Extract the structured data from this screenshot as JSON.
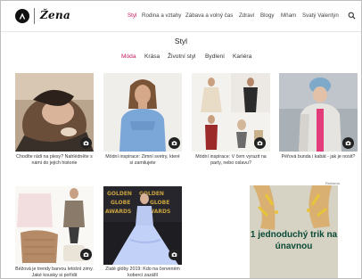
{
  "header": {
    "logo_text": "Žena",
    "nav": [
      "Styl",
      "Rodina a vztahy",
      "Zábava a volný čas",
      "Zdraví",
      "Blogy",
      "Mňam",
      "Svatý Valentýn"
    ],
    "active_nav": "Styl",
    "accent_color": "#c2185b"
  },
  "section": {
    "title": "Styl",
    "tabs": [
      "Móda",
      "Krása",
      "Životní styl",
      "Bydlení",
      "Kariéra"
    ],
    "active_tab": "Móda"
  },
  "articles": [
    {
      "caption": "Chodíte rádi na plesy? Nahlédněte s námi do jejich historie",
      "icon": "camera-icon"
    },
    {
      "caption": "Módní inspirace: Zimní svetry, které si zamilujete",
      "icon": "camera-icon"
    },
    {
      "caption": "Módní inspirace: V čem vyrazit na party, nebo oslavu?",
      "icon": "camera-icon"
    },
    {
      "caption": "Péřová bunda i kabát - jak je nosit?",
      "icon": "camera-icon"
    },
    {
      "caption": "Béžová je trendy barvou letošní zimy. Jaké kousky si pořídit",
      "icon": "camera-icon"
    },
    {
      "caption": "Zlaté glóby 2019: Kdo na červeném koberci zazářil",
      "icon": "camera-icon"
    }
  ],
  "ad": {
    "label": "Reklama",
    "text": "1 jednoduchý trik na únavnou"
  }
}
